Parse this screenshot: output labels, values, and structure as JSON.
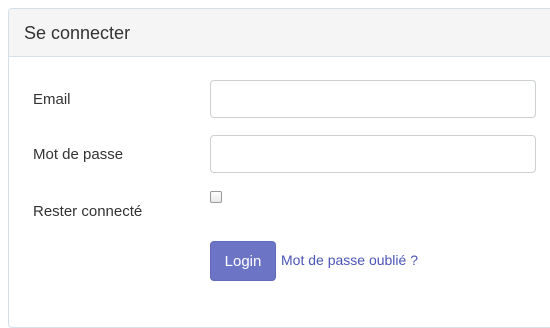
{
  "panel": {
    "title": "Se connecter"
  },
  "form": {
    "email_label": "Email",
    "email_value": "",
    "password_label": "Mot de passe",
    "password_value": "",
    "remember_label": "Rester connecté",
    "remember_checked": false,
    "login_label": "Login",
    "forgot_label": "Mot de passe oublié ?"
  },
  "colors": {
    "accent": "#6c74c5",
    "link": "#4a55b5",
    "panel_border": "#d3e0e9",
    "heading_bg": "#f5f5f5"
  }
}
